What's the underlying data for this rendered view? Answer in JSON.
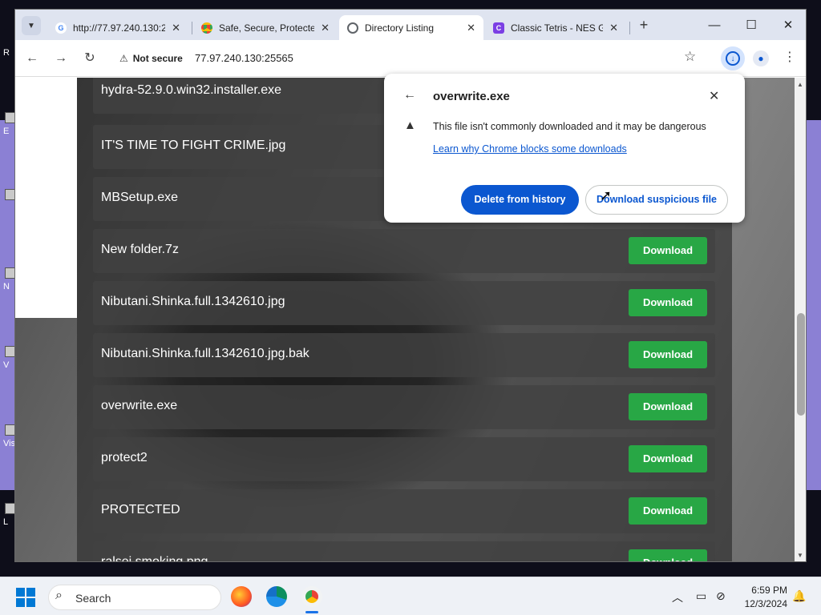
{
  "desktop": {
    "icon_letters": [
      "R",
      "E",
      "N",
      "V",
      "Vis",
      "L"
    ]
  },
  "browser": {
    "tabs": [
      {
        "title": "http://77.97.240.130:2",
        "icon": "google-g-icon",
        "active": false
      },
      {
        "title": "Safe, Secure, Protecte",
        "icon": "chrome-icon",
        "active": false
      },
      {
        "title": "Directory Listing",
        "icon": "globe-icon",
        "active": true
      },
      {
        "title": "Classic Tetris - NES G",
        "icon": "tetris-c-icon",
        "active": false
      }
    ],
    "security_label": "Not secure",
    "url": "77.97.240.130:25565"
  },
  "listing": {
    "download_label": "Download",
    "files": [
      "hydra-52.9.0.win32.installer.exe",
      "IT'S TIME TO FIGHT CRIME.jpg",
      "MBSetup.exe",
      "New folder.7z",
      "Nibutani.Shinka.full.1342610.jpg",
      "Nibutani.Shinka.full.1342610.jpg.bak",
      "overwrite.exe",
      "protect2",
      "PROTECTED",
      "ralsei smoking.png"
    ]
  },
  "download_popup": {
    "filename": "overwrite.exe",
    "message": "This file isn't commonly downloaded and it may be dangerous",
    "learn_link": "Learn why Chrome blocks some downloads",
    "delete_button": "Delete from history",
    "download_button": "Download suspicious file"
  },
  "taskbar": {
    "search_placeholder": "Search",
    "time": "6:59 PM",
    "date": "12/3/2024"
  },
  "colors": {
    "download_green": "#28a745",
    "chrome_blue": "#0b57d0",
    "desktop_purple": "#8b80d4"
  }
}
